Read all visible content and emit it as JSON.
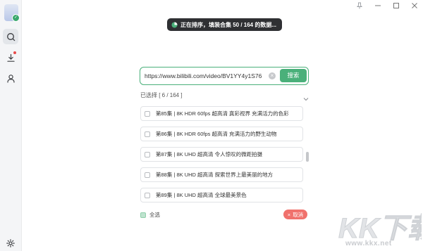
{
  "toast": {
    "text": "正在排序，填装合集 50 / 164 的数据..."
  },
  "search": {
    "url_value": "https://www.bilibili.com/video/BV1YY4y1S76",
    "button_label": "搜索"
  },
  "selection": {
    "summary": "已选择 [ 6 / 164 ]"
  },
  "episodes": [
    {
      "title": "第85集 | 8K HDR 60fps 超高清 真彩视界 充满活力的色彩",
      "checked": false
    },
    {
      "title": "第86集 | 8K HDR 60fps 超高清 充满活力的野生动物",
      "checked": false
    },
    {
      "title": "第87集 | 8K UHD 超高清 令人惊叹的微距拍摄",
      "checked": false
    },
    {
      "title": "第88集 | 8K UHD 超高清 探索世界上最美丽的地方",
      "checked": false
    },
    {
      "title": "第89集 | 8K UHD 超高清 全球最美景色",
      "checked": false
    }
  ],
  "footer": {
    "select_all_label": "全选",
    "cancel_label": "取消"
  },
  "watermark": {
    "text": "KK下载",
    "url": "www.kkx.net"
  },
  "colors": {
    "accent": "#4ab07a",
    "cancel": "#f0716c",
    "toast_bg": "#2f3033"
  },
  "icons": {
    "sidebar": [
      "avatar",
      "search-icon",
      "download-icon",
      "user-icon",
      "settings-icon"
    ],
    "window": [
      "pin-icon",
      "minimize-icon",
      "maximize-icon",
      "close-icon"
    ]
  }
}
